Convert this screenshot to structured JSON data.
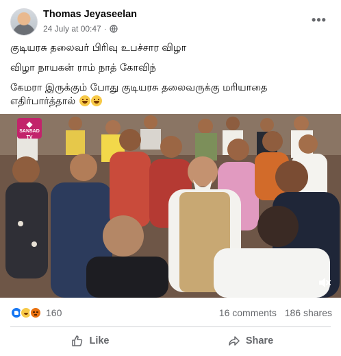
{
  "post": {
    "author": "Thomas Jeyaseelan",
    "timestamp": "24 July at 00:47",
    "audience_icon": "globe-icon",
    "more_icon": "more-options-icon",
    "text_lines": [
      "குடியரசு தலைவர் பிரிவு உபச்சார விழா",
      "விழா நாயகன் ராம் நாத் கோவிந்",
      "கேமரா இருக்கும் போது குடியரசு தலைவருக்கு மரியாதை எதிர்பார்த்தால்"
    ],
    "text_emoji": [
      "grinning-sweat-emoji",
      "grinning-sweat-emoji"
    ],
    "media": {
      "type": "video-still",
      "channel_logo": "SANSAD TV",
      "mute_icon": "speaker-muted-icon"
    }
  },
  "stats": {
    "reactions": [
      "like",
      "haha",
      "angry"
    ],
    "reaction_count": "160",
    "comments": "16 comments",
    "shares": "186 shares"
  },
  "actions": {
    "like_label": "Like",
    "share_label": "Share"
  },
  "colors": {
    "like_blue": "#1877f2",
    "secondary_text": "#65676b",
    "divider": "#ced0d4"
  }
}
